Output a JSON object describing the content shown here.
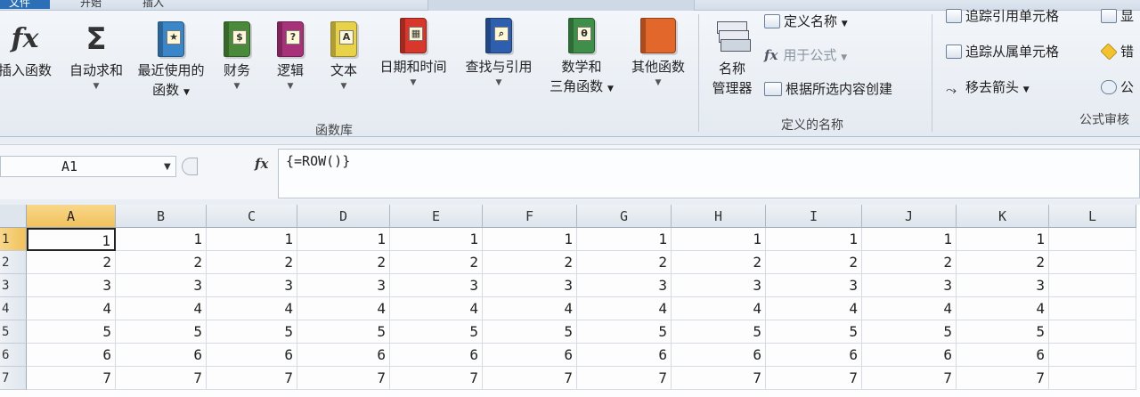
{
  "tabs": {
    "file": "文件",
    "home": "开始",
    "insert": "插入"
  },
  "ribbon": {
    "function_library": {
      "label": "函数库",
      "insert_function": "插入函数",
      "autosum": "自动求和",
      "recent_line1": "最近使用的",
      "recent_line2": "函数",
      "financial": "财务",
      "logical": "逻辑",
      "text": "文本",
      "datetime": "日期和时间",
      "lookup": "查找与引用",
      "math_line1": "数学和",
      "math_line2": "三角函数",
      "more": "其他函数"
    },
    "defined_names": {
      "label": "定义的名称",
      "name_manager_line1": "名称",
      "name_manager_line2": "管理器",
      "define_name": "定义名称",
      "use_in_formula": "用于公式",
      "create_from_selection": "根据所选内容创建"
    },
    "formula_auditing": {
      "label": "公式审核",
      "trace_precedents": "追踪引用单元格",
      "trace_dependents": "追踪从属单元格",
      "remove_arrows": "移去箭头",
      "show": "显",
      "error": "错",
      "evaluate": "公"
    }
  },
  "formula_bar": {
    "name_box": "A1",
    "formula": "{=ROW()}"
  },
  "sheet": {
    "columns": [
      "A",
      "B",
      "C",
      "D",
      "E",
      "F",
      "G",
      "H",
      "I",
      "J",
      "K",
      "L"
    ],
    "rows": [
      "1",
      "2",
      "3",
      "4",
      "5",
      "6",
      "7"
    ],
    "values": [
      [
        "1",
        "1",
        "1",
        "1",
        "1",
        "1",
        "1",
        "1",
        "1",
        "1",
        "1",
        ""
      ],
      [
        "2",
        "2",
        "2",
        "2",
        "2",
        "2",
        "2",
        "2",
        "2",
        "2",
        "2",
        ""
      ],
      [
        "3",
        "3",
        "3",
        "3",
        "3",
        "3",
        "3",
        "3",
        "3",
        "3",
        "3",
        ""
      ],
      [
        "4",
        "4",
        "4",
        "4",
        "4",
        "4",
        "4",
        "4",
        "4",
        "4",
        "4",
        ""
      ],
      [
        "5",
        "5",
        "5",
        "5",
        "5",
        "5",
        "5",
        "5",
        "5",
        "5",
        "5",
        ""
      ],
      [
        "6",
        "6",
        "6",
        "6",
        "6",
        "6",
        "6",
        "6",
        "6",
        "6",
        "6",
        ""
      ],
      [
        "7",
        "7",
        "7",
        "7",
        "7",
        "7",
        "7",
        "7",
        "7",
        "7",
        "7",
        ""
      ]
    ],
    "active_cell": "A1"
  },
  "colors": {
    "book_financial": "#4a8a3a",
    "book_logical": "#a8327a",
    "book_text": "#e8d24a",
    "book_datetime": "#d8372b",
    "book_lookup": "#2e5fae",
    "book_math": "#3f8f4a",
    "book_more": "#e2672a",
    "book_recent": "#3a86c8"
  }
}
